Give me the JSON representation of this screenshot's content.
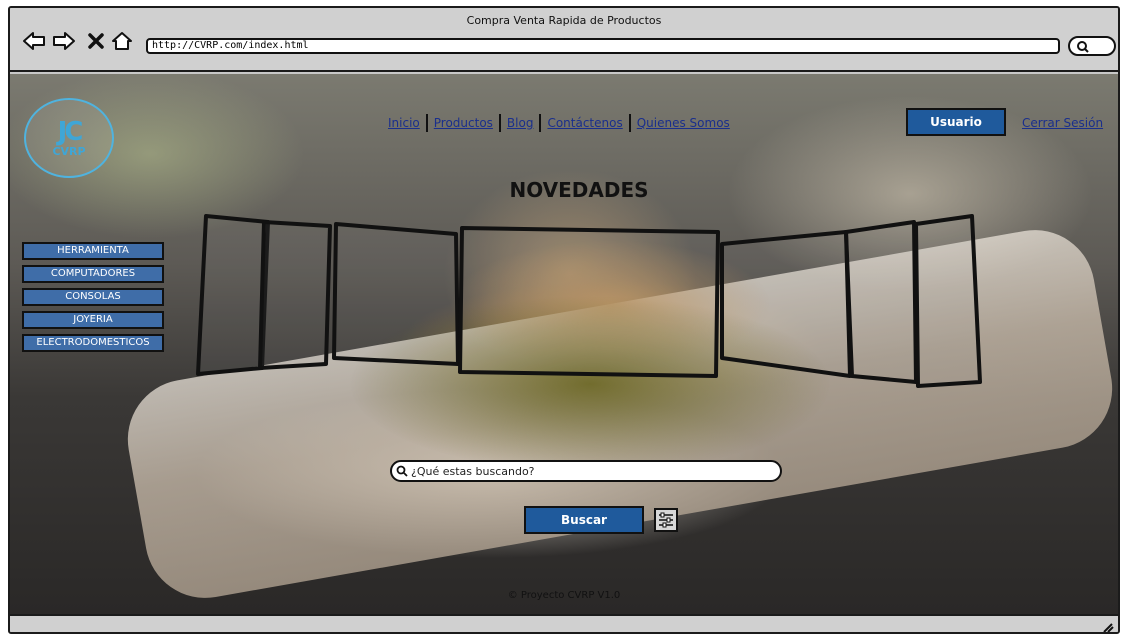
{
  "window": {
    "title": "Compra Venta Rapida de Productos",
    "url": "http://CVRP.com/index.html"
  },
  "logo": {
    "mark": "JC",
    "text": "CVRP"
  },
  "nav": {
    "items": [
      "Inicio",
      "Productos",
      "Blog",
      "Contáctenos",
      "Quienes Somos"
    ]
  },
  "account": {
    "user_label": "Usuario",
    "logout_label": "Cerrar Sesión"
  },
  "section_title": "NOVEDADES",
  "categories": [
    "HERRAMIENTA",
    "COMPUTADORES",
    "CONSOLAS",
    "JOYERIA",
    "ELECTRODOMESTICOS"
  ],
  "search": {
    "placeholder": "¿Qué estas buscando?",
    "button_label": "Buscar"
  },
  "footer": "© Proyecto CVRP V1.0",
  "colors": {
    "primary_button": "#1f5a9c",
    "category_button": "#3f6da8",
    "link": "#1a2f8c",
    "logo": "#3fa6d6"
  },
  "icons": [
    "back-arrow-icon",
    "forward-arrow-icon",
    "close-icon",
    "home-icon",
    "search-icon",
    "filter-icon",
    "resize-grip-icon"
  ]
}
